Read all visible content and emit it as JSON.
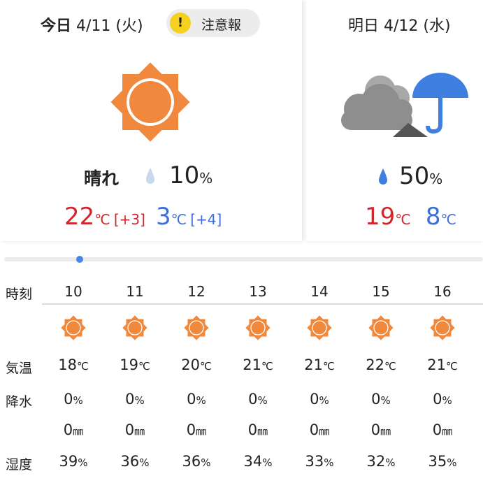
{
  "today": {
    "label": "今日",
    "date": "4/11 (火)",
    "alert": {
      "icon": "!",
      "label": "注意報"
    },
    "icon": "sun-icon",
    "condition": "晴れ",
    "precip_icon": "raindrop-icon",
    "precip": "10",
    "precip_unit": "%",
    "high": "22",
    "high_unit": "℃",
    "high_diff": "[+3]",
    "low": "3",
    "low_unit": "℃",
    "low_diff": "[+4]"
  },
  "tomorrow": {
    "date": "明日 4/12 (水)",
    "icon": "cloud-umbrella-icon",
    "precip_icon": "raindrop-icon",
    "precip": "50",
    "precip_unit": "%",
    "high": "19",
    "high_unit": "℃",
    "low": "8",
    "low_unit": "℃"
  },
  "hourly": {
    "labels": {
      "time": "時刻",
      "temp": "気温",
      "precip": "降水",
      "humidity": "湿度"
    },
    "hours": [
      "10",
      "11",
      "12",
      "13",
      "14",
      "15",
      "16"
    ],
    "icons": [
      "sun-icon",
      "sun-icon",
      "sun-icon",
      "sun-icon",
      "sun-icon",
      "sun-icon",
      "sun-icon"
    ],
    "temps": [
      "18",
      "19",
      "20",
      "21",
      "21",
      "22",
      "21"
    ],
    "temp_unit": "℃",
    "precip_pct": [
      "0",
      "0",
      "0",
      "0",
      "0",
      "0",
      "0"
    ],
    "precip_pct_unit": "%",
    "precip_mm": [
      "0",
      "0",
      "0",
      "0",
      "0",
      "0",
      "0"
    ],
    "precip_mm_unit": "㎜",
    "humidity": [
      "39",
      "36",
      "36",
      "34",
      "33",
      "32",
      "35"
    ],
    "humidity_unit": "%"
  },
  "colors": {
    "high": "#d2262b",
    "low": "#3d6fd6",
    "sun": "#f0883e",
    "alert": "#f4d11f",
    "slider": "#4a86e8",
    "umbrella": "#3f7fe0",
    "cloud": "#a8a8a8"
  }
}
